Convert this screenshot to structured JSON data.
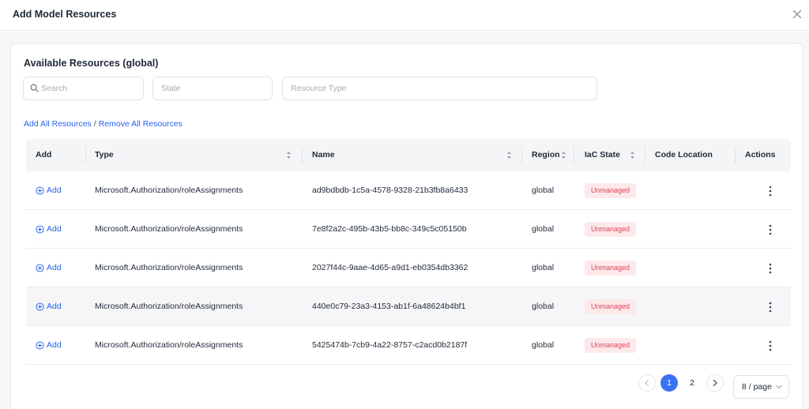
{
  "dialog": {
    "title": "Add Model Resources"
  },
  "panel": {
    "title": "Available Resources (global)",
    "filters": {
      "search_placeholder": "Search",
      "state_placeholder": "State",
      "resource_type_placeholder": "Resource Type"
    },
    "links": {
      "add_all": "Add All Resources",
      "separator": "/",
      "remove_all": "Remove All Resources"
    }
  },
  "table": {
    "columns": {
      "add": "Add",
      "type": "Type",
      "name": "Name",
      "region": "Region",
      "iac_state": "IaC State",
      "code_location": "Code Location",
      "actions": "Actions"
    },
    "add_label": "Add",
    "rows": [
      {
        "type": "Microsoft.Authorization/roleAssignments",
        "name": "ad9bdbdb-1c5a-4578-9328-21b3fb8a6433",
        "region": "global",
        "iac_state": "Unmanaged",
        "code_location": ""
      },
      {
        "type": "Microsoft.Authorization/roleAssignments",
        "name": "7e8f2a2c-495b-43b5-bb8c-349c5c05150b",
        "region": "global",
        "iac_state": "Unmanaged",
        "code_location": ""
      },
      {
        "type": "Microsoft.Authorization/roleAssignments",
        "name": "2027f44c-9aae-4d65-a9d1-eb0354db3362",
        "region": "global",
        "iac_state": "Unmanaged",
        "code_location": ""
      },
      {
        "type": "Microsoft.Authorization/roleAssignments",
        "name": "440e0c79-23a3-4153-ab1f-6a48624b4bf1",
        "region": "global",
        "iac_state": "Unmanaged",
        "code_location": ""
      },
      {
        "type": "Microsoft.Authorization/roleAssignments",
        "name": "5425474b-7cb9-4a22-8757-c2acd0b2187f",
        "region": "global",
        "iac_state": "Unmanaged",
        "code_location": ""
      }
    ]
  },
  "pagination": {
    "pages": [
      "1",
      "2"
    ],
    "current_page": "1",
    "page_size": "8 / page"
  },
  "colors": {
    "accent": "#2563eb",
    "active_page": "#3b72f3",
    "badge_text": "#d9485f",
    "badge_bg": "#fde8ea"
  },
  "icons": {
    "close": "close-icon",
    "search": "search-icon",
    "sort": "sort-icon",
    "add": "plus-circle-icon",
    "more": "kebab-vertical-icon",
    "prev": "chevron-left-icon",
    "next": "chevron-right-icon",
    "dropdown": "chevron-down-icon"
  }
}
